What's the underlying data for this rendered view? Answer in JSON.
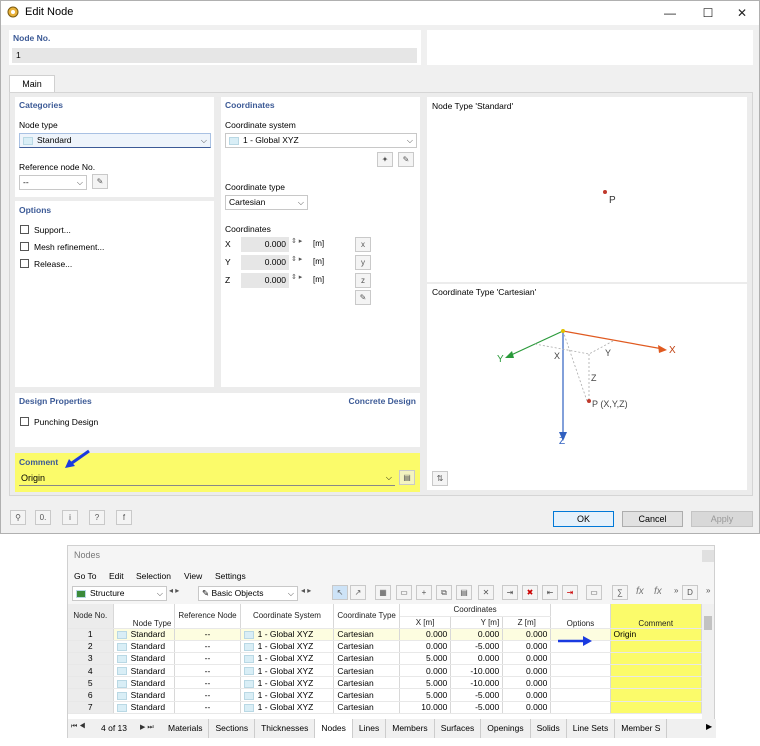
{
  "dialog": {
    "title": "Edit Node",
    "node_no_label": "Node No.",
    "node_no_value": "1",
    "tab_main": "Main"
  },
  "categories": {
    "heading": "Categories",
    "node_type_label": "Node type",
    "node_type_value": "Standard",
    "ref_node_label": "Reference node No.",
    "ref_node_value": "--"
  },
  "options": {
    "heading": "Options",
    "items": [
      "Support...",
      "Mesh refinement...",
      "Release..."
    ]
  },
  "coordinates": {
    "heading": "Coordinates",
    "system_label": "Coordinate system",
    "system_value": "1 - Global XYZ",
    "type_label": "Coordinate type",
    "type_value": "Cartesian",
    "coords_label": "Coordinates",
    "rows": [
      {
        "axis": "X",
        "value": "0.000",
        "unit": "[m]"
      },
      {
        "axis": "Y",
        "value": "0.000",
        "unit": "[m]"
      },
      {
        "axis": "Z",
        "value": "0.000",
        "unit": "[m]"
      }
    ]
  },
  "design": {
    "heading": "Design Properties",
    "addon": "Concrete Design",
    "punching": "Punching Design"
  },
  "comment": {
    "label": "Comment",
    "value": "Origin"
  },
  "preview": {
    "node_type_title": "Node Type 'Standard'",
    "node_label": "P",
    "coord_type_title": "Coordinate Type 'Cartesian'",
    "axis_x": "X",
    "axis_y": "Y",
    "axis_z": "Z",
    "point_label": "P (X,Y,Z)"
  },
  "buttons": {
    "ok": "OK",
    "cancel": "Cancel",
    "apply": "Apply"
  },
  "table": {
    "title": "Nodes",
    "menu": [
      "Go To",
      "Edit",
      "Selection",
      "View",
      "Settings"
    ],
    "combo1": "Structure",
    "combo2": "Basic Objects",
    "headers": {
      "node_no": "Node No.",
      "node_type": "Node Type",
      "ref_node": "Reference Node",
      "coord_system": "Coordinate System",
      "coord_type": "Coordinate Type",
      "coordinates": "Coordinates",
      "x": "X [m]",
      "y": "Y [m]",
      "z": "Z [m]",
      "options": "Options",
      "comment": "Comment"
    },
    "rows": [
      {
        "no": "1",
        "type": "Standard",
        "ref": "--",
        "sys": "1 - Global XYZ",
        "ctype": "Cartesian",
        "x": "0.000",
        "y": "0.000",
        "z": "0.000",
        "comment": "Origin"
      },
      {
        "no": "2",
        "type": "Standard",
        "ref": "--",
        "sys": "1 - Global XYZ",
        "ctype": "Cartesian",
        "x": "0.000",
        "y": "-5.000",
        "z": "0.000",
        "comment": ""
      },
      {
        "no": "3",
        "type": "Standard",
        "ref": "--",
        "sys": "1 - Global XYZ",
        "ctype": "Cartesian",
        "x": "5.000",
        "y": "0.000",
        "z": "0.000",
        "comment": ""
      },
      {
        "no": "4",
        "type": "Standard",
        "ref": "--",
        "sys": "1 - Global XYZ",
        "ctype": "Cartesian",
        "x": "0.000",
        "y": "-10.000",
        "z": "0.000",
        "comment": ""
      },
      {
        "no": "5",
        "type": "Standard",
        "ref": "--",
        "sys": "1 - Global XYZ",
        "ctype": "Cartesian",
        "x": "5.000",
        "y": "-10.000",
        "z": "0.000",
        "comment": ""
      },
      {
        "no": "6",
        "type": "Standard",
        "ref": "--",
        "sys": "1 - Global XYZ",
        "ctype": "Cartesian",
        "x": "5.000",
        "y": "-5.000",
        "z": "0.000",
        "comment": ""
      },
      {
        "no": "7",
        "type": "Standard",
        "ref": "--",
        "sys": "1 - Global XYZ",
        "ctype": "Cartesian",
        "x": "10.000",
        "y": "-5.000",
        "z": "0.000",
        "comment": ""
      }
    ],
    "pager": "4 of 13",
    "tabs": [
      "Materials",
      "Sections",
      "Thicknesses",
      "Nodes",
      "Lines",
      "Members",
      "Surfaces",
      "Openings",
      "Solids",
      "Line Sets",
      "Member S"
    ]
  },
  "colors": {
    "accent_blue": "#3c5a96",
    "highlight": "#fbfb6a",
    "selected_tab": "#ffffff"
  }
}
